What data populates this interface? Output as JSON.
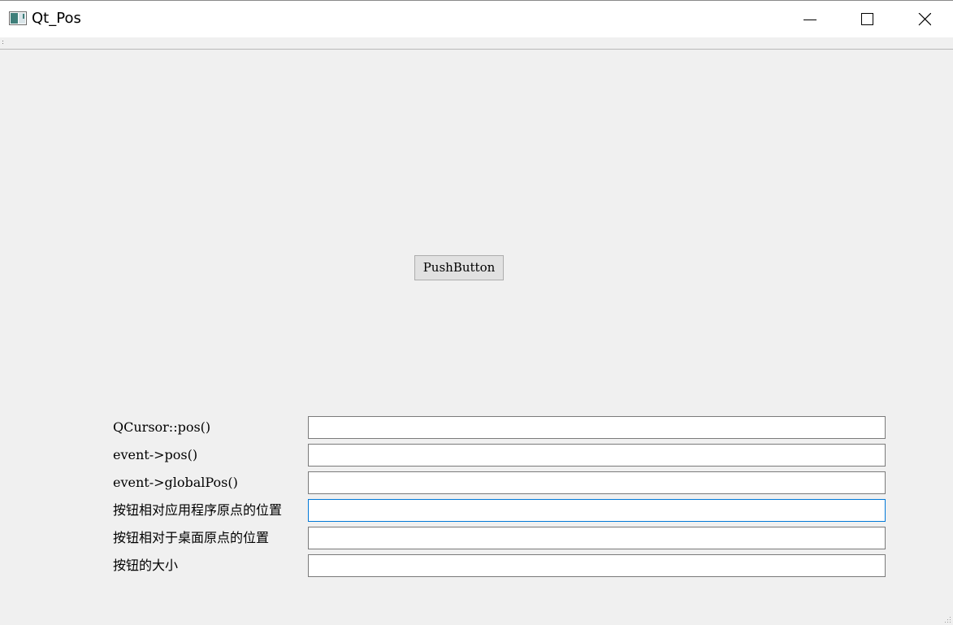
{
  "window": {
    "title": "Qt_Pos",
    "icons": {
      "app": "app-icon",
      "minimize": "minimize-icon",
      "maximize": "maximize-icon",
      "close": "close-icon"
    }
  },
  "main": {
    "push_button_label": "PushButton"
  },
  "form": {
    "rows": [
      {
        "label": "QCursor::pos()",
        "value": ""
      },
      {
        "label": "event->pos()",
        "value": ""
      },
      {
        "label": "event->globalPos()",
        "value": ""
      },
      {
        "label": "按钮相对应用程序原点的位置",
        "value": ""
      },
      {
        "label": "按钮相对于桌面原点的位置",
        "value": ""
      },
      {
        "label": "按钮的大小",
        "value": ""
      }
    ]
  },
  "colors": {
    "background": "#f0f0f0",
    "titlebar": "#ffffff",
    "focus_border": "#0078d7",
    "input_border": "#7a7a7a"
  }
}
